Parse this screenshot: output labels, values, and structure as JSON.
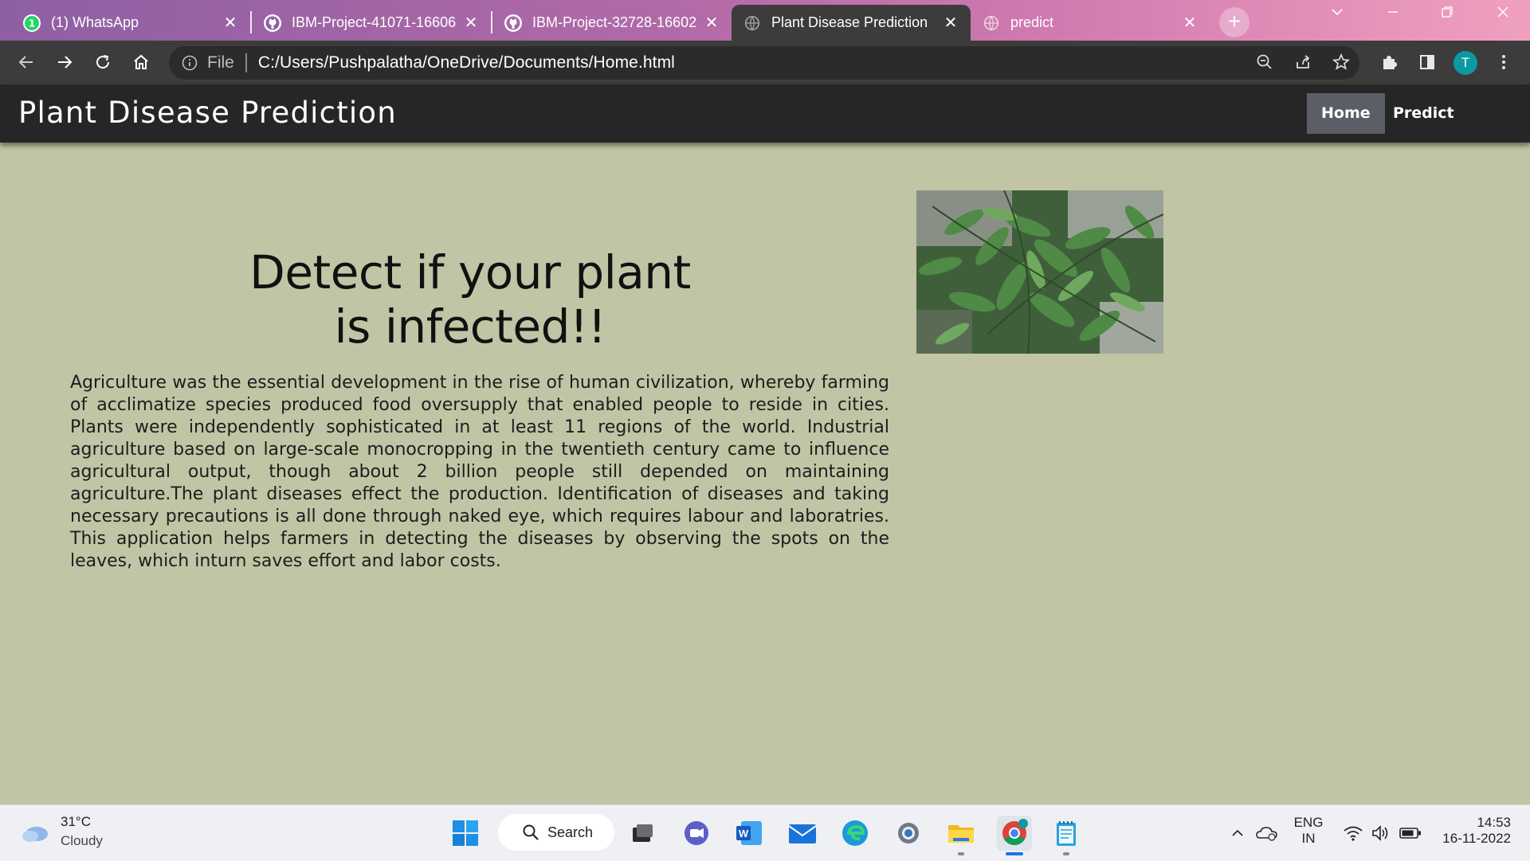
{
  "browser": {
    "tabs": [
      {
        "title": "(1) WhatsApp",
        "icon": "whatsapp-icon"
      },
      {
        "title": "IBM-Project-41071-16606",
        "icon": "github-icon"
      },
      {
        "title": "IBM-Project-32728-16602",
        "icon": "github-icon"
      },
      {
        "title": "Plant Disease Prediction",
        "icon": "globe-icon",
        "active": true
      },
      {
        "title": "predict",
        "icon": "globe-icon"
      }
    ],
    "address": {
      "scheme": "File",
      "url": "C:/Users/Pushpalatha/OneDrive/Documents/Home.html"
    },
    "profile_initial": "T",
    "whatsapp_badge": "1"
  },
  "site": {
    "title": "Plant Disease Prediction",
    "nav": [
      {
        "label": "Home",
        "current": true
      },
      {
        "label": "Predict",
        "current": false
      }
    ],
    "hero": {
      "heading_line1": "Detect if your plant",
      "heading_line2": "is infected!!",
      "body": "Agriculture was the essential development in the rise of human civilization, whereby farming of acclimatize species produced food oversupply that enabled people to reside in cities. Plants were independently sophisticated in at least 11 regions of the world. Industrial agriculture based on large-scale monocropping in the twentieth century came to influence agricultural output, though about 2 billion people still depended on maintaining agriculture.The plant diseases effect the production. Identification of diseases and taking necessary precautions is all done through naked eye, which requires labour and laboratries. This application helps farmers in detecting the diseases by observing the spots on the leaves, which inturn saves effort and labor costs."
    },
    "image": "curry-leaves-photo"
  },
  "taskbar": {
    "weather": {
      "temp": "31°C",
      "condition": "Cloudy"
    },
    "search_label": "Search",
    "language": {
      "line1": "ENG",
      "line2": "IN"
    },
    "time": "14:53",
    "date": "16-11-2022"
  },
  "colors": {
    "page_bg": "#c2c5a5",
    "header_bg": "#262626",
    "nav_active_bg": "#5b5e66",
    "tab_active_bg": "#3c3c3c"
  }
}
